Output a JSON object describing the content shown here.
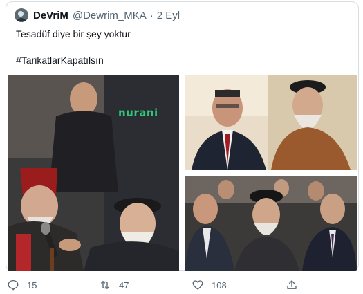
{
  "tweet": {
    "display_name": "DeVriM",
    "handle": "@Dewrim_MKA",
    "separator": "·",
    "date": "2 Eyl",
    "line1": "Tesadüf diye bir şey yoktur",
    "line2": "#TarikatlarKapatılsın"
  },
  "media": {
    "watermark": "nurani"
  },
  "actions": {
    "reply_count": "15",
    "retweet_count": "47",
    "like_count": "108"
  },
  "icons": {
    "reply": "comment-bubble-icon",
    "retweet": "retweet-arrows-icon",
    "like": "heart-outline-icon",
    "share": "share-upload-icon"
  },
  "colors": {
    "text": "#0f1419",
    "secondary": "#536471",
    "border": "#d8dde2",
    "watermark": "#3fbf7f"
  }
}
